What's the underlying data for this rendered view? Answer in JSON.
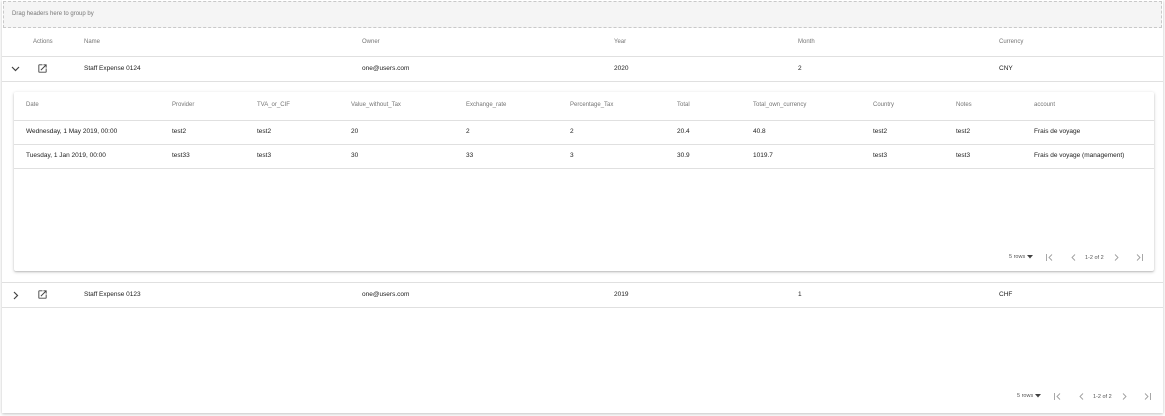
{
  "group_bar": {
    "hint": "Drag headers here to group by"
  },
  "main_table": {
    "headers": {
      "actions": "Actions",
      "name": "Name",
      "owner": "Owner",
      "year": "Year",
      "month": "Month",
      "currency": "Currency"
    },
    "rows": [
      {
        "name": "Staff Expense 0124",
        "owner": "one@users.com",
        "year": "2020",
        "month": "2",
        "currency": "CNY",
        "expanded": true
      },
      {
        "name": "Staff Expense 0123",
        "owner": "one@users.com",
        "year": "2019",
        "month": "1",
        "currency": "CHF",
        "expanded": false
      }
    ]
  },
  "detail_table": {
    "headers": {
      "date": "Date",
      "provider": "Provider",
      "tva": "TVA_or_CIF",
      "value": "Value_without_Tax",
      "exchange": "Exchange_rate",
      "pct_tax": "Percentage_Tax",
      "total": "Total",
      "total_own": "Total_own_currency",
      "country": "Country",
      "notes": "Notes",
      "account": "account"
    },
    "rows": [
      {
        "date": "Wednesday, 1 May 2019, 00:00",
        "provider": "test2",
        "tva": "test2",
        "value": "20",
        "exchange": "2",
        "pct_tax": "2",
        "total": "20.4",
        "total_own": "40.8",
        "country": "test2",
        "notes": "test2",
        "account": "Frais de voyage"
      },
      {
        "date": "Tuesday, 1 Jan 2019, 00:00",
        "provider": "test33",
        "tva": "test3",
        "value": "30",
        "exchange": "33",
        "pct_tax": "3",
        "total": "30.9",
        "total_own": "1019.7",
        "country": "test3",
        "notes": "test3",
        "account": "Frais de voyage (management)"
      }
    ],
    "pagination": {
      "rows_label": "5 rows",
      "range": "1-2 of 2"
    }
  },
  "main_pagination": {
    "rows_label": "5 rows",
    "range": "1-2 of 2"
  },
  "icons": {
    "expand_less": "chevron-down-icon",
    "expand_more": "chevron-right-icon",
    "open": "open-in-new-icon",
    "first": "first-page-icon",
    "prev": "chevron-left-icon",
    "next": "chevron-right-icon",
    "last": "last-page-icon",
    "dropdown": "arrow-drop-down-icon"
  },
  "colors": {
    "divider": "#e0e0e0",
    "group_bar_bg": "#f5f5f5",
    "icon": "#424242",
    "pager_disabled": "#9e9e9e"
  }
}
